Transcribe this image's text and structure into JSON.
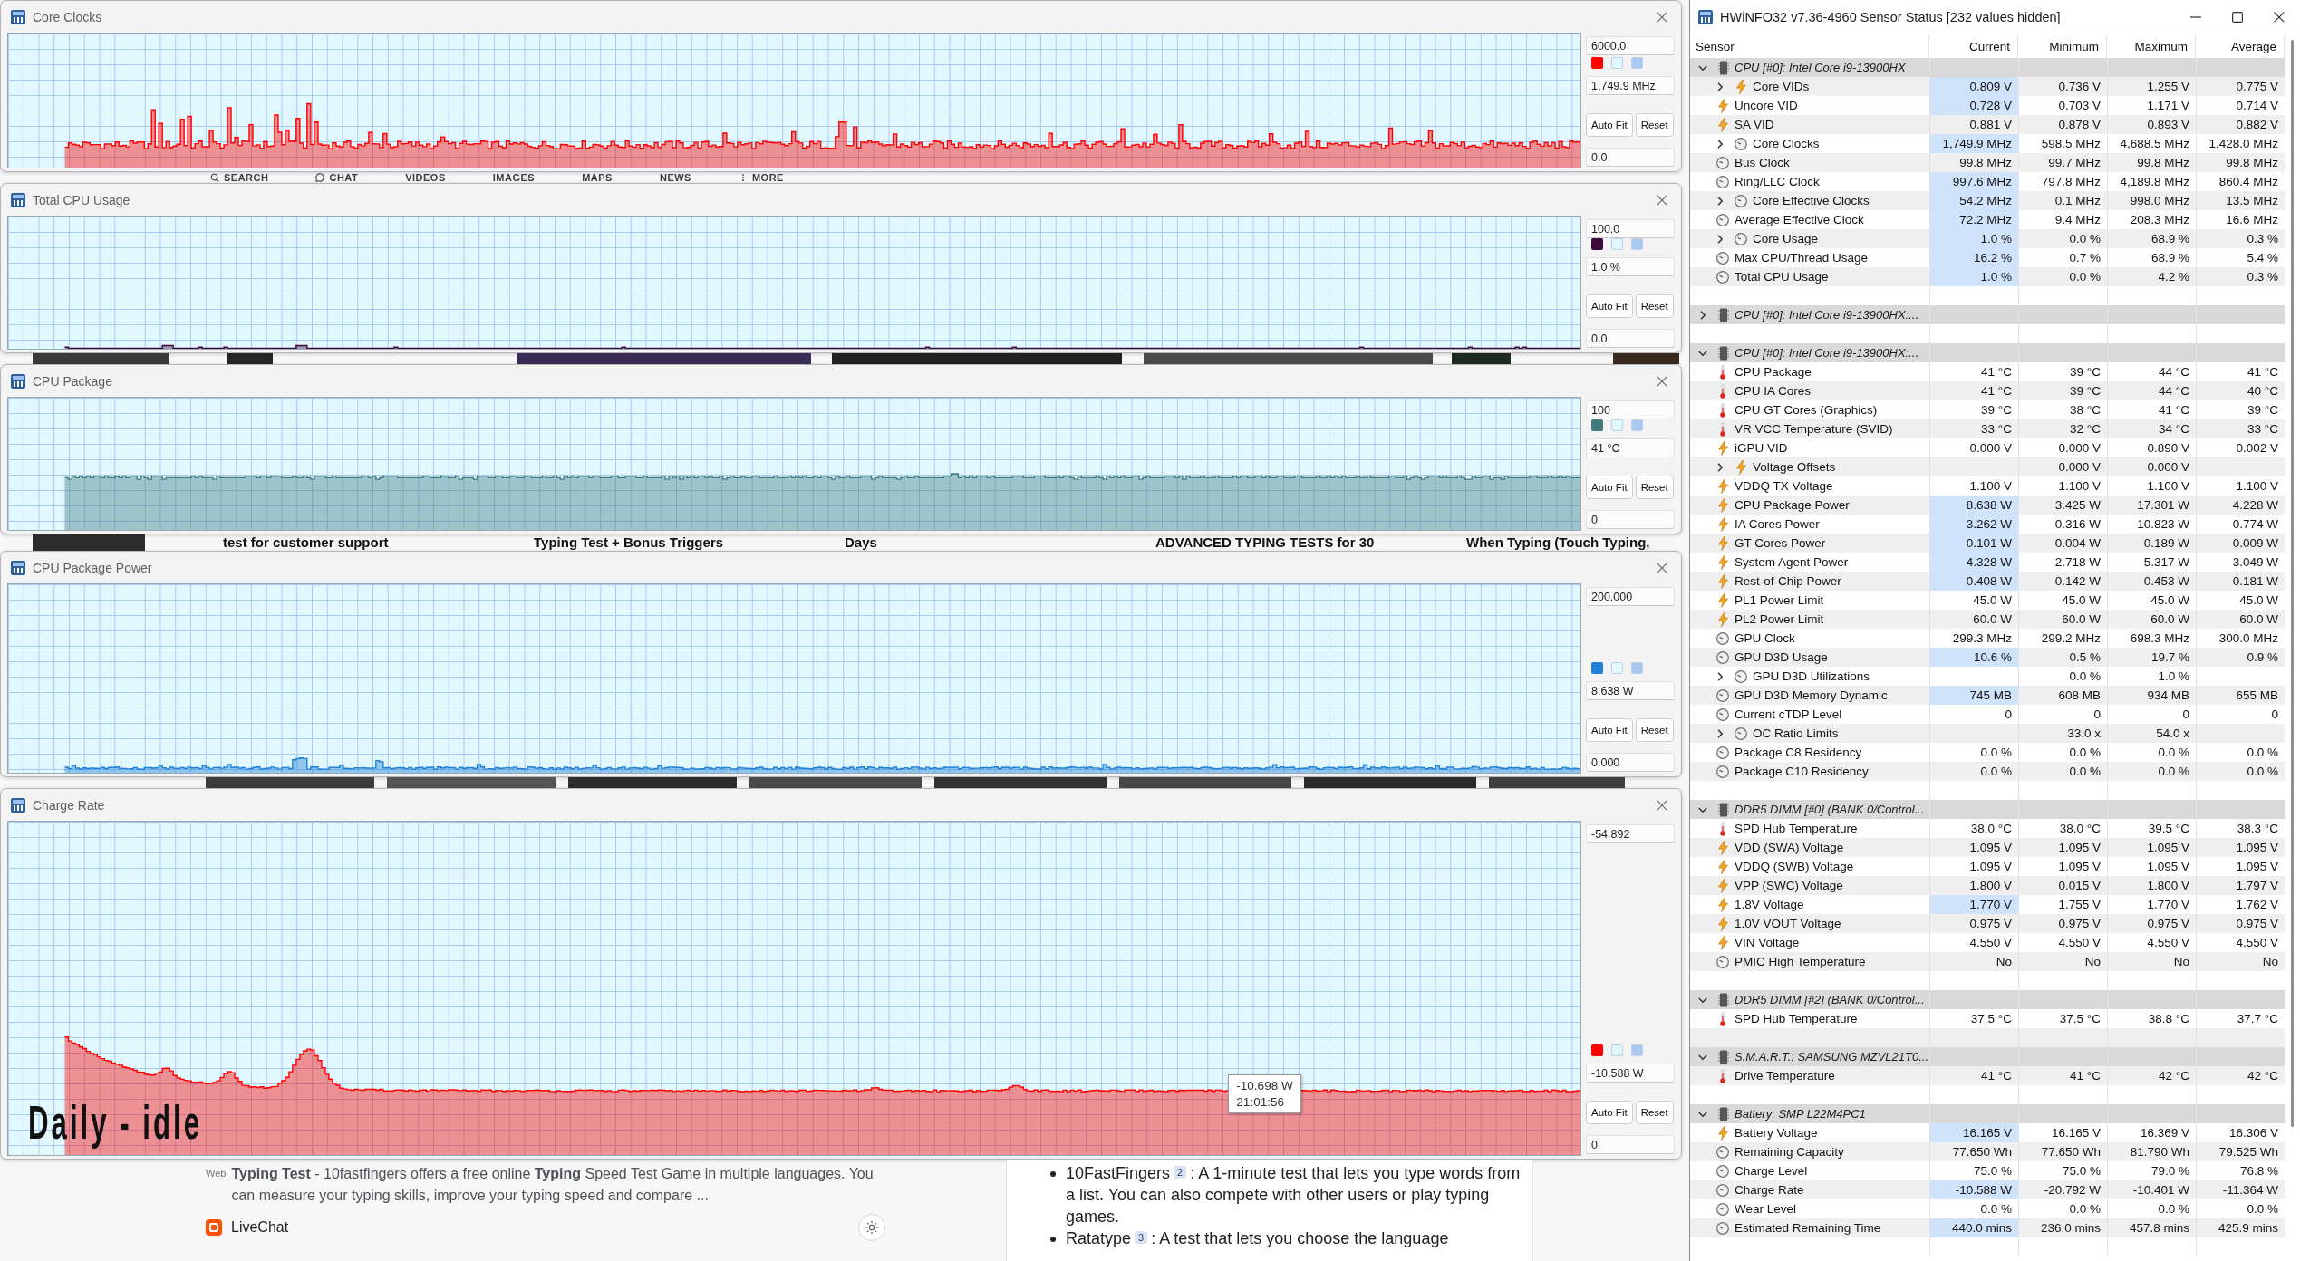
{
  "graphs": [
    {
      "title": "Core Clocks",
      "scale_max": "6000.0",
      "color": "#ff0000",
      "current": "1,749.9 MHz",
      "buttons": [
        "Auto Fit",
        "Reset"
      ],
      "scale_min": "0.0"
    },
    {
      "title": "Total CPU Usage",
      "scale_max": "100.0",
      "color": "#3b0a3b",
      "current": "1.0 %",
      "buttons": [
        "Auto Fit",
        "Reset"
      ],
      "scale_min": "0.0"
    },
    {
      "title": "CPU Package",
      "scale_max": "100",
      "color": "#417b7e",
      "current": "41 °C",
      "buttons": [
        "Auto Fit",
        "Reset"
      ],
      "scale_min": "0"
    },
    {
      "title": "CPU Package Power",
      "scale_max": "200.000",
      "color": "#1f80d6",
      "current": "8.638 W",
      "buttons": [
        "Auto Fit",
        "Reset"
      ],
      "scale_min": "0.000"
    },
    {
      "title": "Charge Rate",
      "scale_max": "-54.892",
      "color": "#ff0000",
      "current": "-10.588 W",
      "buttons": [
        "Auto Fit",
        "Reset"
      ],
      "scale_min": "0",
      "annotation": "Daily - idle",
      "tooltip": {
        "value": "-10.698 W",
        "time": "21:01:56"
      }
    }
  ],
  "browser": {
    "nav_tabs": [
      {
        "label": "SEARCH",
        "kind": "search"
      },
      {
        "label": "CHAT",
        "kind": "chat"
      },
      {
        "label": "VIDEOS",
        "kind": "text"
      },
      {
        "label": "IMAGES",
        "kind": "text"
      },
      {
        "label": "MAPS",
        "kind": "text"
      },
      {
        "label": "NEWS",
        "kind": "text"
      },
      {
        "label": "MORE",
        "kind": "more"
      }
    ],
    "video_titles": [
      "test for customer support",
      "Typing Test + Bonus Triggers",
      "Days",
      "ADVANCED TYPING TESTS for 30",
      "When Typing (Touch Typing,"
    ],
    "result": {
      "source": "Web",
      "snippet": "**Typing Test** - 10fastfingers offers a free online **Typing** Speed Test Game in multiple languages. You can measure your typing skills, improve your typing speed and compare ..."
    },
    "site": {
      "name": "LiveChat"
    },
    "answer": [
      {
        "name": "10FastFingers",
        "citation": "2",
        "text": ": A 1-minute test that lets you type words from a list. You can also compete with other users or play typing games."
      },
      {
        "name": "Ratatype",
        "citation": "3",
        "text": ": A test that lets you choose the language"
      }
    ]
  },
  "sensor_window": {
    "title": "HWiNFO32 v7.36-4960 Sensor Status [232 values hidden]",
    "columns": [
      "Sensor",
      "Current",
      "Minimum",
      "Maximum",
      "Average"
    ],
    "groups": [
      {
        "label": "CPU [#0]: Intel Core i9-13900HX",
        "expanded": true,
        "sensors": [
          {
            "name": "Core VIDs",
            "kind": "voltage",
            "collapsed": true,
            "highlighted": true,
            "current": "0.809 V",
            "minimum": "0.736 V",
            "maximum": "1.255 V",
            "average": "0.775 V"
          },
          {
            "name": "Uncore VID",
            "kind": "voltage",
            "collapsed": false,
            "highlighted": true,
            "current": "0.728 V",
            "minimum": "0.703 V",
            "maximum": "1.171 V",
            "average": "0.714 V"
          },
          {
            "name": "SA VID",
            "kind": "voltage",
            "collapsed": false,
            "highlighted": false,
            "current": "0.881 V",
            "minimum": "0.878 V",
            "maximum": "0.893 V",
            "average": "0.882 V"
          },
          {
            "name": "Core Clocks",
            "kind": "clock",
            "collapsed": true,
            "highlighted": true,
            "current": "1,749.9 MHz",
            "minimum": "598.5 MHz",
            "maximum": "4,688.5 MHz",
            "average": "1,428.0 MHz"
          },
          {
            "name": "Bus Clock",
            "kind": "clock",
            "collapsed": false,
            "highlighted": false,
            "current": "99.8 MHz",
            "minimum": "99.7 MHz",
            "maximum": "99.8 MHz",
            "average": "99.8 MHz"
          },
          {
            "name": "Ring/LLC Clock",
            "kind": "clock",
            "collapsed": false,
            "highlighted": true,
            "current": "997.6 MHz",
            "minimum": "797.8 MHz",
            "maximum": "4,189.8 MHz",
            "average": "860.4 MHz"
          },
          {
            "name": "Core Effective Clocks",
            "kind": "clock",
            "collapsed": true,
            "highlighted": true,
            "current": "54.2 MHz",
            "minimum": "0.1 MHz",
            "maximum": "998.0 MHz",
            "average": "13.5 MHz"
          },
          {
            "name": "Average Effective Clock",
            "kind": "clock",
            "collapsed": false,
            "highlighted": true,
            "current": "72.2 MHz",
            "minimum": "9.4 MHz",
            "maximum": "208.3 MHz",
            "average": "16.6 MHz"
          },
          {
            "name": "Core Usage",
            "kind": "clock",
            "collapsed": true,
            "highlighted": true,
            "current": "1.0 %",
            "minimum": "0.0 %",
            "maximum": "68.9 %",
            "average": "0.3 %"
          },
          {
            "name": "Max CPU/Thread Usage",
            "kind": "clock",
            "collapsed": false,
            "highlighted": true,
            "current": "16.2 %",
            "minimum": "0.7 %",
            "maximum": "68.9 %",
            "average": "5.4 %"
          },
          {
            "name": "Total CPU Usage",
            "kind": "clock",
            "collapsed": false,
            "highlighted": true,
            "current": "1.0 %",
            "minimum": "0.0 %",
            "maximum": "4.2 %",
            "average": "0.3 %"
          }
        ]
      },
      {
        "label": "CPU [#0]: Intel Core i9-13900HX:...",
        "expanded": false
      },
      {
        "label": "CPU [#0]: Intel Core i9-13900HX:...",
        "expanded": true,
        "sensors": [
          {
            "name": "CPU Package",
            "kind": "temperature",
            "collapsed": false,
            "highlighted": false,
            "current": "41 °C",
            "minimum": "39 °C",
            "maximum": "44 °C",
            "average": "41 °C"
          },
          {
            "name": "CPU IA Cores",
            "kind": "temperature",
            "collapsed": false,
            "highlighted": false,
            "current": "41 °C",
            "minimum": "39 °C",
            "maximum": "44 °C",
            "average": "40 °C"
          },
          {
            "name": "CPU GT Cores (Graphics)",
            "kind": "temperature",
            "collapsed": false,
            "highlighted": false,
            "current": "39 °C",
            "minimum": "38 °C",
            "maximum": "41 °C",
            "average": "39 °C"
          },
          {
            "name": "VR VCC Temperature (SVID)",
            "kind": "temperature",
            "collapsed": false,
            "highlighted": false,
            "current": "33 °C",
            "minimum": "32 °C",
            "maximum": "34 °C",
            "average": "33 °C"
          },
          {
            "name": "iGPU VID",
            "kind": "voltage",
            "collapsed": false,
            "highlighted": false,
            "current": "0.000 V",
            "minimum": "0.000 V",
            "maximum": "0.890 V",
            "average": "0.002 V"
          },
          {
            "name": "Voltage Offsets",
            "kind": "voltage",
            "collapsed": true,
            "highlighted": false,
            "minimum": "0.000 V",
            "maximum": "0.000 V"
          },
          {
            "name": "VDDQ TX Voltage",
            "kind": "voltage",
            "collapsed": false,
            "highlighted": false,
            "current": "1.100 V",
            "minimum": "1.100 V",
            "maximum": "1.100 V",
            "average": "1.100 V"
          },
          {
            "name": "CPU Package Power",
            "kind": "power",
            "collapsed": false,
            "highlighted": true,
            "current": "8.638 W",
            "minimum": "3.425 W",
            "maximum": "17.301 W",
            "average": "4.228 W"
          },
          {
            "name": "IA Cores Power",
            "kind": "power",
            "collapsed": false,
            "highlighted": true,
            "current": "3.262 W",
            "minimum": "0.316 W",
            "maximum": "10.823 W",
            "average": "0.774 W"
          },
          {
            "name": "GT Cores Power",
            "kind": "power",
            "collapsed": false,
            "highlighted": true,
            "current": "0.101 W",
            "minimum": "0.004 W",
            "maximum": "0.189 W",
            "average": "0.009 W"
          },
          {
            "name": "System Agent Power",
            "kind": "power",
            "collapsed": false,
            "highlighted": true,
            "current": "4.328 W",
            "minimum": "2.718 W",
            "maximum": "5.317 W",
            "average": "3.049 W"
          },
          {
            "name": "Rest-of-Chip Power",
            "kind": "power",
            "collapsed": false,
            "highlighted": true,
            "current": "0.408 W",
            "minimum": "0.142 W",
            "maximum": "0.453 W",
            "average": "0.181 W"
          },
          {
            "name": "PL1 Power Limit",
            "kind": "power",
            "collapsed": false,
            "highlighted": false,
            "current": "45.0 W",
            "minimum": "45.0 W",
            "maximum": "45.0 W",
            "average": "45.0 W"
          },
          {
            "name": "PL2 Power Limit",
            "kind": "power",
            "collapsed": false,
            "highlighted": false,
            "current": "60.0 W",
            "minimum": "60.0 W",
            "maximum": "60.0 W",
            "average": "60.0 W"
          },
          {
            "name": "GPU Clock",
            "kind": "clock",
            "collapsed": false,
            "highlighted": false,
            "current": "299.3 MHz",
            "minimum": "299.2 MHz",
            "maximum": "698.3 MHz",
            "average": "300.0 MHz"
          },
          {
            "name": "GPU D3D Usage",
            "kind": "clock",
            "collapsed": false,
            "highlighted": true,
            "current": "10.6 %",
            "minimum": "0.5 %",
            "maximum": "19.7 %",
            "average": "0.9 %"
          },
          {
            "name": "GPU D3D Utilizations",
            "kind": "clock",
            "collapsed": true,
            "highlighted": false,
            "minimum": "0.0 %",
            "maximum": "1.0 %"
          },
          {
            "name": "GPU D3D Memory Dynamic",
            "kind": "clock",
            "collapsed": false,
            "highlighted": true,
            "current": "745 MB",
            "minimum": "608 MB",
            "maximum": "934 MB",
            "average": "655 MB"
          },
          {
            "name": "Current cTDP Level",
            "kind": "clock",
            "collapsed": false,
            "highlighted": false,
            "current": "0",
            "minimum": "0",
            "maximum": "0",
            "average": "0"
          },
          {
            "name": "OC Ratio Limits",
            "kind": "clock",
            "collapsed": true,
            "highlighted": false,
            "minimum": "33.0 x",
            "maximum": "54.0 x"
          },
          {
            "name": "Package C8 Residency",
            "kind": "clock",
            "collapsed": false,
            "highlighted": false,
            "current": "0.0 %",
            "minimum": "0.0 %",
            "maximum": "0.0 %",
            "average": "0.0 %"
          },
          {
            "name": "Package C10 Residency",
            "kind": "clock",
            "collapsed": false,
            "highlighted": false,
            "current": "0.0 %",
            "minimum": "0.0 %",
            "maximum": "0.0 %",
            "average": "0.0 %"
          }
        ]
      },
      {
        "label": "DDR5 DIMM [#0] (BANK 0/Control...",
        "expanded": true,
        "sensors": [
          {
            "name": "SPD Hub Temperature",
            "kind": "temperature",
            "collapsed": false,
            "highlighted": false,
            "current": "38.0 °C",
            "minimum": "38.0 °C",
            "maximum": "39.5 °C",
            "average": "38.3 °C"
          },
          {
            "name": "VDD (SWA) Voltage",
            "kind": "voltage",
            "collapsed": false,
            "highlighted": false,
            "current": "1.095 V",
            "minimum": "1.095 V",
            "maximum": "1.095 V",
            "average": "1.095 V"
          },
          {
            "name": "VDDQ (SWB) Voltage",
            "kind": "voltage",
            "collapsed": false,
            "highlighted": false,
            "current": "1.095 V",
            "minimum": "1.095 V",
            "maximum": "1.095 V",
            "average": "1.095 V"
          },
          {
            "name": "VPP (SWC) Voltage",
            "kind": "voltage",
            "collapsed": false,
            "highlighted": false,
            "current": "1.800 V",
            "minimum": "0.015 V",
            "maximum": "1.800 V",
            "average": "1.797 V"
          },
          {
            "name": "1.8V Voltage",
            "kind": "voltage",
            "collapsed": false,
            "highlighted": true,
            "current": "1.770 V",
            "minimum": "1.755 V",
            "maximum": "1.770 V",
            "average": "1.762 V"
          },
          {
            "name": "1.0V VOUT Voltage",
            "kind": "voltage",
            "collapsed": false,
            "highlighted": false,
            "current": "0.975 V",
            "minimum": "0.975 V",
            "maximum": "0.975 V",
            "average": "0.975 V"
          },
          {
            "name": "VIN Voltage",
            "kind": "voltage",
            "collapsed": false,
            "highlighted": false,
            "current": "4.550 V",
            "minimum": "4.550 V",
            "maximum": "4.550 V",
            "average": "4.550 V"
          },
          {
            "name": "PMIC High Temperature",
            "kind": "clock",
            "collapsed": false,
            "highlighted": false,
            "current": "No",
            "minimum": "No",
            "maximum": "No",
            "average": "No"
          }
        ]
      },
      {
        "label": "DDR5 DIMM [#2] (BANK 0/Control...",
        "expanded": true,
        "sensors": [
          {
            "name": "SPD Hub Temperature",
            "kind": "temperature",
            "collapsed": false,
            "highlighted": false,
            "current": "37.5 °C",
            "minimum": "37.5 °C",
            "maximum": "38.8 °C",
            "average": "37.7 °C"
          }
        ]
      },
      {
        "label": "S.M.A.R.T.: SAMSUNG MZVL21T0...",
        "expanded": true,
        "sensors": [
          {
            "name": "Drive Temperature",
            "kind": "temperature",
            "collapsed": false,
            "highlighted": false,
            "current": "41 °C",
            "minimum": "41 °C",
            "maximum": "42 °C",
            "average": "42 °C"
          }
        ]
      },
      {
        "label": "Battery: SMP L22M4PC1",
        "expanded": true,
        "sensors": [
          {
            "name": "Battery Voltage",
            "kind": "voltage",
            "collapsed": false,
            "highlighted": true,
            "current": "16.165 V",
            "minimum": "16.165 V",
            "maximum": "16.369 V",
            "average": "16.306 V"
          },
          {
            "name": "Remaining Capacity",
            "kind": "clock",
            "collapsed": false,
            "highlighted": false,
            "current": "77.650 Wh",
            "minimum": "77.650 Wh",
            "maximum": "81.790 Wh",
            "average": "79.525 Wh"
          },
          {
            "name": "Charge Level",
            "kind": "clock",
            "collapsed": false,
            "highlighted": false,
            "current": "75.0 %",
            "minimum": "75.0 %",
            "maximum": "79.0 %",
            "average": "76.8 %"
          },
          {
            "name": "Charge Rate",
            "kind": "clock",
            "collapsed": false,
            "highlighted": true,
            "current": "-10.588 W",
            "minimum": "-20.792 W",
            "maximum": "-10.401 W",
            "average": "-11.364 W"
          },
          {
            "name": "Wear Level",
            "kind": "clock",
            "collapsed": false,
            "highlighted": false,
            "current": "0.0 %",
            "minimum": "0.0 %",
            "maximum": "0.0 %",
            "average": "0.0 %"
          },
          {
            "name": "Estimated Remaining Time",
            "kind": "clock",
            "collapsed": false,
            "highlighted": true,
            "current": "440.0 mins",
            "minimum": "236.0 mins",
            "maximum": "457.8 mins",
            "average": "425.9 mins"
          }
        ]
      }
    ]
  }
}
